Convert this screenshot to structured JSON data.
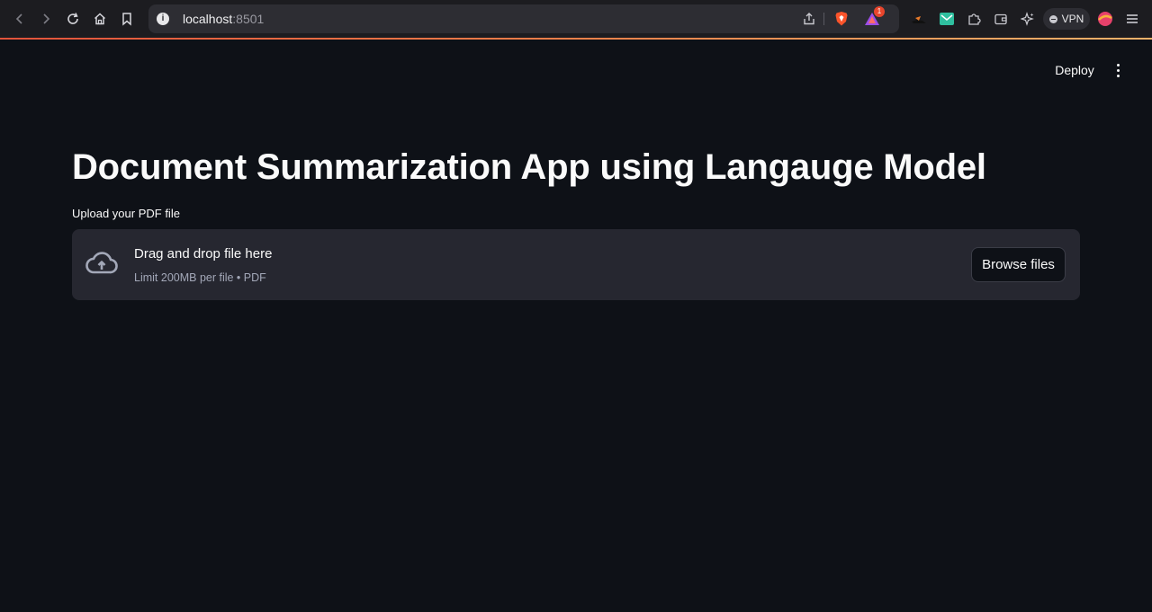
{
  "browser": {
    "url_host": "localhost",
    "url_port": ":8501",
    "vpn_label": "VPN",
    "notification_count": "1",
    "accent_color": "#e2533b"
  },
  "header": {
    "deploy_label": "Deploy"
  },
  "main": {
    "title": "Document Summarization App using Langauge Model",
    "uploader": {
      "label": "Upload your PDF file",
      "drop_text": "Drag and drop file here",
      "limit_text": "Limit 200MB per file • PDF",
      "browse_label": "Browse files"
    }
  },
  "icons": [
    "back-icon",
    "forward-icon",
    "reload-icon",
    "home-icon",
    "bookmark-icon",
    "info-icon",
    "share-icon",
    "brave-shield-icon",
    "brave-rewards-icon",
    "leo-extension-icon",
    "mail-extension-icon",
    "extensions-icon",
    "wallet-icon",
    "leo-ai-icon",
    "profile-icon",
    "menu-icon",
    "kebab-menu-icon",
    "cloud-upload-icon"
  ]
}
